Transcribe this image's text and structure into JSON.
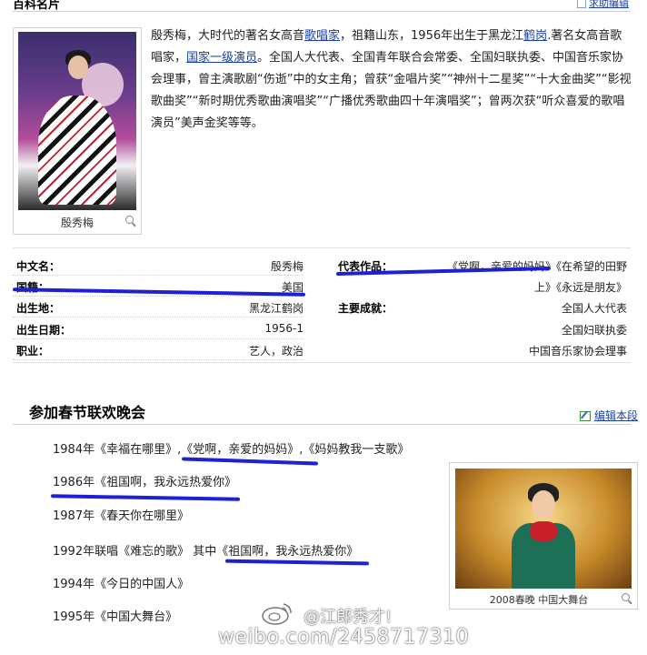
{
  "header": {
    "title": "百科名片",
    "help_link": "求助编辑"
  },
  "profile_photo": {
    "caption": "殷秀梅"
  },
  "intro": {
    "p1": "殷秀梅，大时代的著名女高音",
    "link_singer": "歌唱家",
    "p2": "，祖籍山东，1956年出生于黑龙江",
    "link_hegang": "鹤岗",
    "p3": ".著名女高音歌唱家，",
    "link_actor": "国家一级演员",
    "p4": "。全国人大代表、全国青年联合会常委、全国妇联执委、中国音乐家协会理事，曾主演歌剧“伤逝”中的女主角；曾获“金唱片奖”“神州十二星奖”“十大金曲奖”“影视歌曲奖”“新时期优秀歌曲演唱奖”“广播优秀歌曲四十年演唱奖”；曾两次获“听众喜爱的歌唱演员”美声金奖等等。"
  },
  "info": {
    "left": [
      {
        "key": "中文名：",
        "value": "殷秀梅"
      },
      {
        "key": "国籍：",
        "value": "美国"
      },
      {
        "key": "出生地：",
        "value": "黑龙江鹤岗"
      },
      {
        "key": "出生日期：",
        "value": "1956-1"
      },
      {
        "key": "职业：",
        "value": "艺人，政治"
      }
    ],
    "right": {
      "works_key": "代表作品：",
      "works_line1": "《党啊，亲爱的妈妈》《在希望的田野",
      "works_line2": "上》《永远是朋友》",
      "achv_key": "主要成就：",
      "achv": [
        "全国人大代表",
        "全国妇联执委",
        "中国音乐家协会理事"
      ]
    }
  },
  "section": {
    "title": "参加春节联欢晚会",
    "edit_link": "编辑本段",
    "performances": [
      "1984年《幸福在哪里》,《党啊，亲爱的妈妈》,《妈妈教我一支歌》",
      "1986年《祖国啊，我永远热爱你》",
      "1987年《春天你在哪里》",
      "1992年联唱《难忘的歌》 其中《祖国啊，我永远热爱你》",
      "1994年《今日的中国人》",
      "1995年《中国大舞台》"
    ],
    "photo_caption": "2008春晚  中国大舞台"
  },
  "watermark": {
    "name": "@江郎秀才!",
    "url": "weibo.com/2458717310"
  },
  "colors": {
    "link": "#1a3fa8",
    "marker": "#1f1fd6"
  }
}
